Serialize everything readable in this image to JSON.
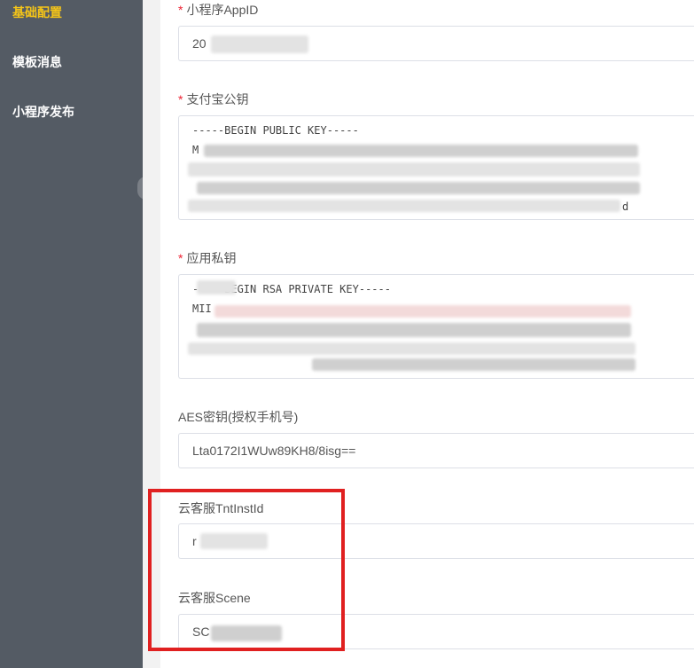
{
  "sidebar": {
    "items": [
      {
        "label": "基础配置",
        "active": true
      },
      {
        "label": "模板消息",
        "active": false
      },
      {
        "label": "小程序发布",
        "active": false
      }
    ]
  },
  "form": {
    "appid": {
      "label": "小程序AppID",
      "required": true,
      "value": "20"
    },
    "alipay_public_key": {
      "label": "支付宝公钥",
      "required": true,
      "lines": [
        "-----BEGIN PUBLIC KEY-----",
        "M",
        "",
        "",
        "d"
      ]
    },
    "app_private_key": {
      "label": "应用私钥",
      "required": true,
      "lines": [
        "-----BEGIN RSA PRIVATE KEY-----",
        "MII"
      ]
    },
    "aes_key": {
      "label": "AES密钥(授权手机号)",
      "value": "Lta0172I1WUw89KH8/8isg=="
    },
    "tnt_inst_id": {
      "label": "云客服TntInstId",
      "value": "r"
    },
    "scene": {
      "label": "云客服Scene",
      "value": "SC"
    }
  },
  "colors": {
    "sidebar_bg": "#545b64",
    "active_nav": "#f5c518",
    "required_mark": "#ee2233",
    "highlight_border": "#e02020"
  }
}
